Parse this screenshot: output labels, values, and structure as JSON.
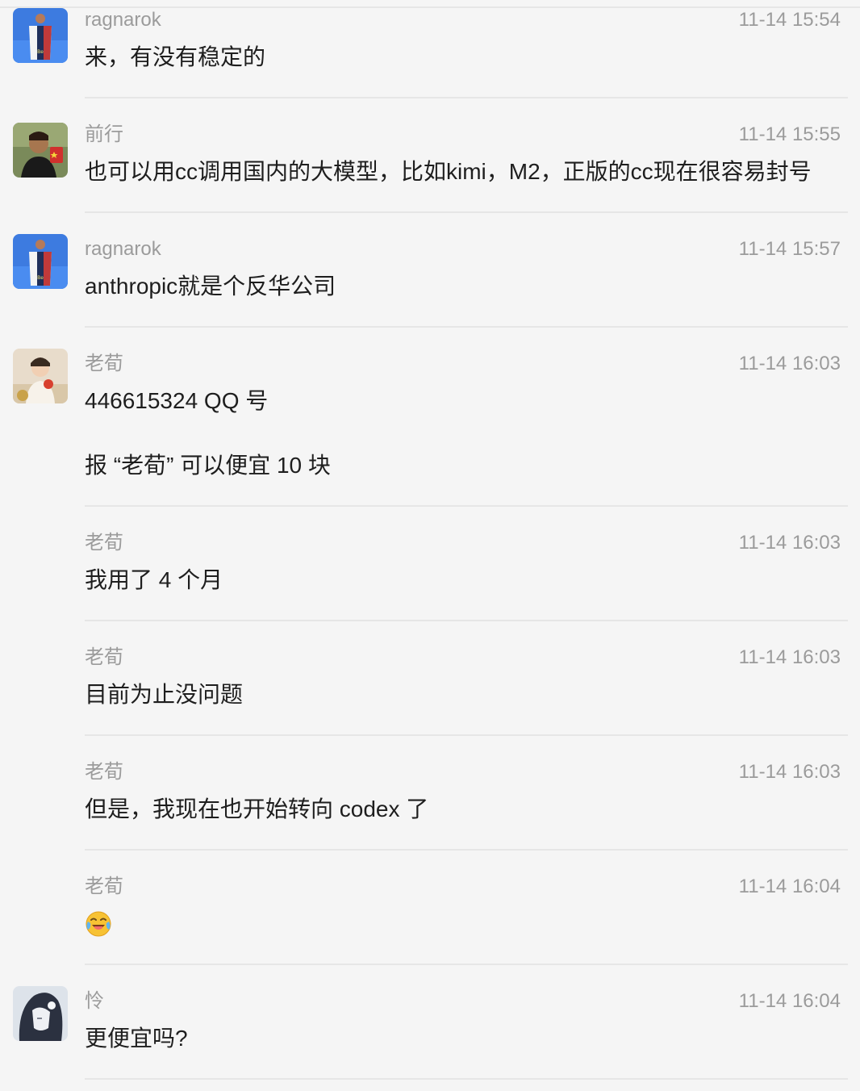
{
  "messages": [
    {
      "sender": "ragnarok",
      "time": "11-14 15:54",
      "lines": [
        "来，有没有稳定的"
      ],
      "avatar": "ragnarok-avatar"
    },
    {
      "sender": "前行",
      "time": "11-14 15:55",
      "lines": [
        "也可以用cc调用国内的大模型，比如kimi，M2，正版的cc现在很容易封号"
      ],
      "avatar": "qianxing-avatar"
    },
    {
      "sender": "ragnarok",
      "time": "11-14 15:57",
      "lines": [
        "anthropic就是个反华公司"
      ],
      "avatar": "ragnarok-avatar"
    },
    {
      "sender": "老荀",
      "time": "11-14 16:03",
      "lines": [
        "446615324 QQ 号",
        "报 “老荀” 可以便宜 10 块"
      ],
      "avatar": "laoxun-avatar"
    },
    {
      "sender": "老荀",
      "time": "11-14 16:03",
      "lines": [
        "我用了 4 个月"
      ]
    },
    {
      "sender": "老荀",
      "time": "11-14 16:03",
      "lines": [
        "目前为止没问题"
      ]
    },
    {
      "sender": "老荀",
      "time": "11-14 16:03",
      "lines": [
        "但是，我现在也开始转向 codex 了"
      ]
    },
    {
      "sender": "老荀",
      "time": "11-14 16:04",
      "emoji": "laughing-crying-emoji"
    },
    {
      "sender": "怜",
      "time": "11-14 16:04",
      "lines": [
        "更便宜吗?"
      ],
      "avatar": "lian-avatar"
    }
  ],
  "colors": {
    "background": "#f5f5f5",
    "meta_text": "#9b9b9b",
    "body_text": "#1e1e1e",
    "divider": "#e6e6e6"
  }
}
